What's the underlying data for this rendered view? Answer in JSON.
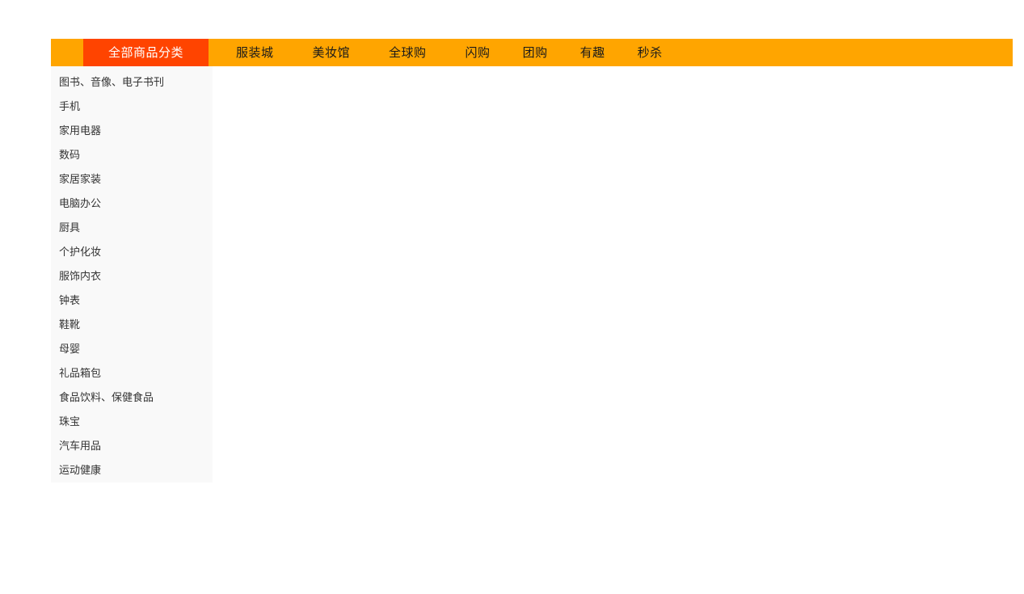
{
  "nav": {
    "active_tab": "全部商品分类",
    "items": [
      {
        "label": "服装城"
      },
      {
        "label": "美妆馆"
      },
      {
        "label": "全球购"
      },
      {
        "label": "闪购"
      },
      {
        "label": "团购"
      },
      {
        "label": "有趣"
      },
      {
        "label": "秒杀"
      }
    ],
    "colors": {
      "bar_background": "#ffa500",
      "active_background": "#ff4400",
      "active_text": "#ffffff",
      "item_text": "#1a1a1a"
    }
  },
  "sidebar": {
    "background": "#f9f9f9",
    "text_color": "#333333",
    "items": [
      {
        "label": "图书、音像、电子书刊"
      },
      {
        "label": "手机"
      },
      {
        "label": "家用电器"
      },
      {
        "label": "数码"
      },
      {
        "label": "家居家装"
      },
      {
        "label": "电脑办公"
      },
      {
        "label": "厨具"
      },
      {
        "label": "个护化妆"
      },
      {
        "label": "服饰内衣"
      },
      {
        "label": "钟表"
      },
      {
        "label": "鞋靴"
      },
      {
        "label": "母婴"
      },
      {
        "label": "礼品箱包"
      },
      {
        "label": "食品饮料、保健食品"
      },
      {
        "label": "珠宝"
      },
      {
        "label": "汽车用品"
      },
      {
        "label": "运动健康"
      }
    ]
  }
}
